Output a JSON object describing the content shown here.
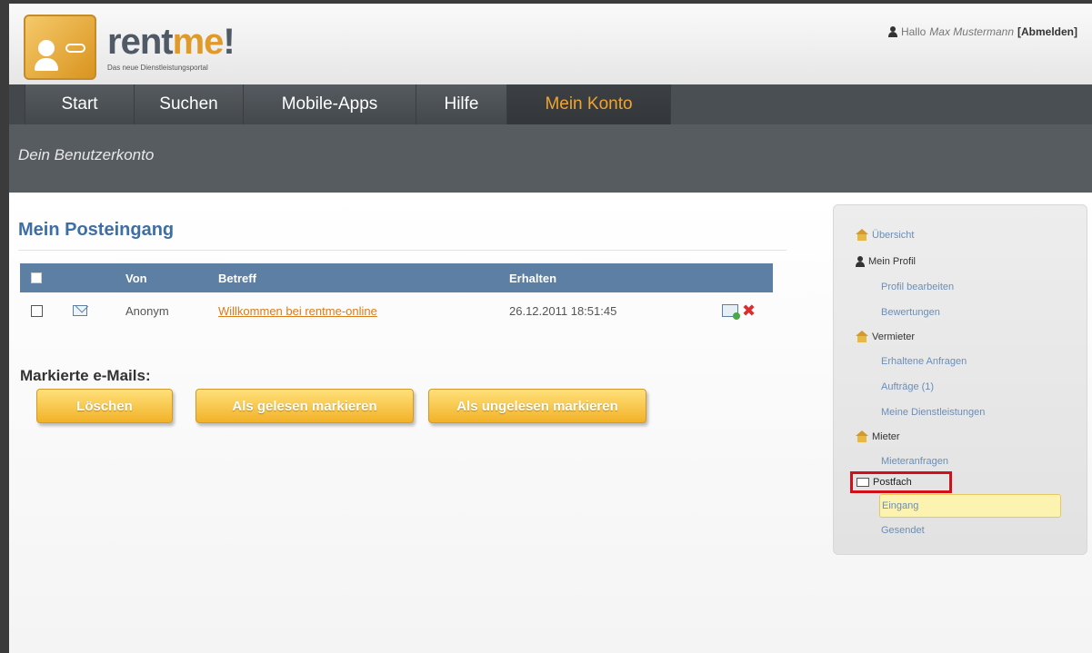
{
  "header": {
    "logo_title_a": "rent",
    "logo_title_b": "me",
    "logo_title_c": "!",
    "logo_subtitle": "Das neue Dienstleistungsportal",
    "greeting": "Hallo",
    "user_name": "Max Mustermann",
    "logout_label": "[Abmelden]"
  },
  "nav": {
    "items": [
      {
        "label": "Start"
      },
      {
        "label": "Suchen"
      },
      {
        "label": "Mobile-Apps"
      },
      {
        "label": "Hilfe"
      },
      {
        "label": "Mein Konto",
        "active": true
      }
    ]
  },
  "subheader": {
    "title": "Dein Benutzerkonto"
  },
  "main": {
    "title": "Mein Posteingang",
    "table": {
      "columns": [
        "Von",
        "Betreff",
        "Erhalten"
      ],
      "rows": [
        {
          "von": "Anonym",
          "betreff": "Willkommen bei rentme-online",
          "erhalten": "26.12.2011 18:51:45"
        }
      ]
    },
    "marked_label": "Markierte e-Mails:",
    "buttons": {
      "delete": "Löschen",
      "mark_read": "Als gelesen markieren",
      "mark_unread": "Als ungelesen markieren"
    }
  },
  "sidebar": {
    "overview": "Übersicht",
    "profile_section": "Mein Profil",
    "edit_profile": "Profil bearbeiten",
    "ratings": "Bewertungen",
    "landlord_section": "Vermieter",
    "received_requests": "Erhaltene Anfragen",
    "orders": "Aufträge (1)",
    "my_services": "Meine Dienstleistungen",
    "tenant_section": "Mieter",
    "tenant_requests": "Mieteranfragen",
    "mailbox_section": "Postfach",
    "inbox": "Eingang",
    "sent": "Gesendet"
  },
  "colors": {
    "accent": "#f0a42e",
    "link": "#3e6ea6",
    "table_header": "#5d7fa4",
    "highlight_border": "#d0101a"
  }
}
